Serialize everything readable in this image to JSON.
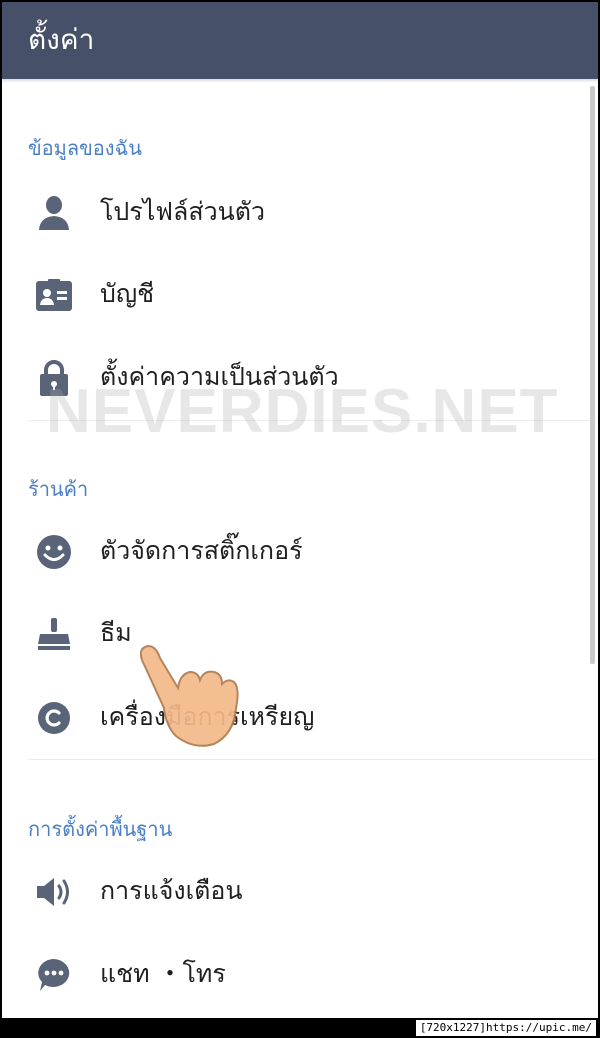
{
  "appbar": {
    "title": "ตั้งค่า"
  },
  "sections": [
    {
      "title": "ข้อมูลของฉัน",
      "items": [
        {
          "icon": "person-icon",
          "label": "โปรไฟล์ส่วนตัว"
        },
        {
          "icon": "id-card-icon",
          "label": "บัญชี"
        },
        {
          "icon": "lock-icon",
          "label": "ตั้งค่าความเป็นส่วนตัว"
        }
      ]
    },
    {
      "title": "ร้านค้า",
      "items": [
        {
          "icon": "smiley-icon",
          "label": "ตัวจัดการสติ๊กเกอร์"
        },
        {
          "icon": "brush-icon",
          "label": "ธีม"
        },
        {
          "icon": "coin-icon",
          "label": "เครื่องมือการเหรียญ"
        }
      ]
    },
    {
      "title": "การตั้งค่าพื้นฐาน",
      "items": [
        {
          "icon": "speaker-icon",
          "label": "การแจ้งเตือน"
        },
        {
          "icon": "chat-bubble-icon",
          "label": "แชท ・โทร"
        }
      ]
    }
  ],
  "watermark": "NEVERDIES.NET",
  "footer": "[720x1227]https://upic.me/",
  "colors": {
    "appbar": "#475069",
    "section_title": "#4a7fc8",
    "icon": "#5a6478"
  }
}
